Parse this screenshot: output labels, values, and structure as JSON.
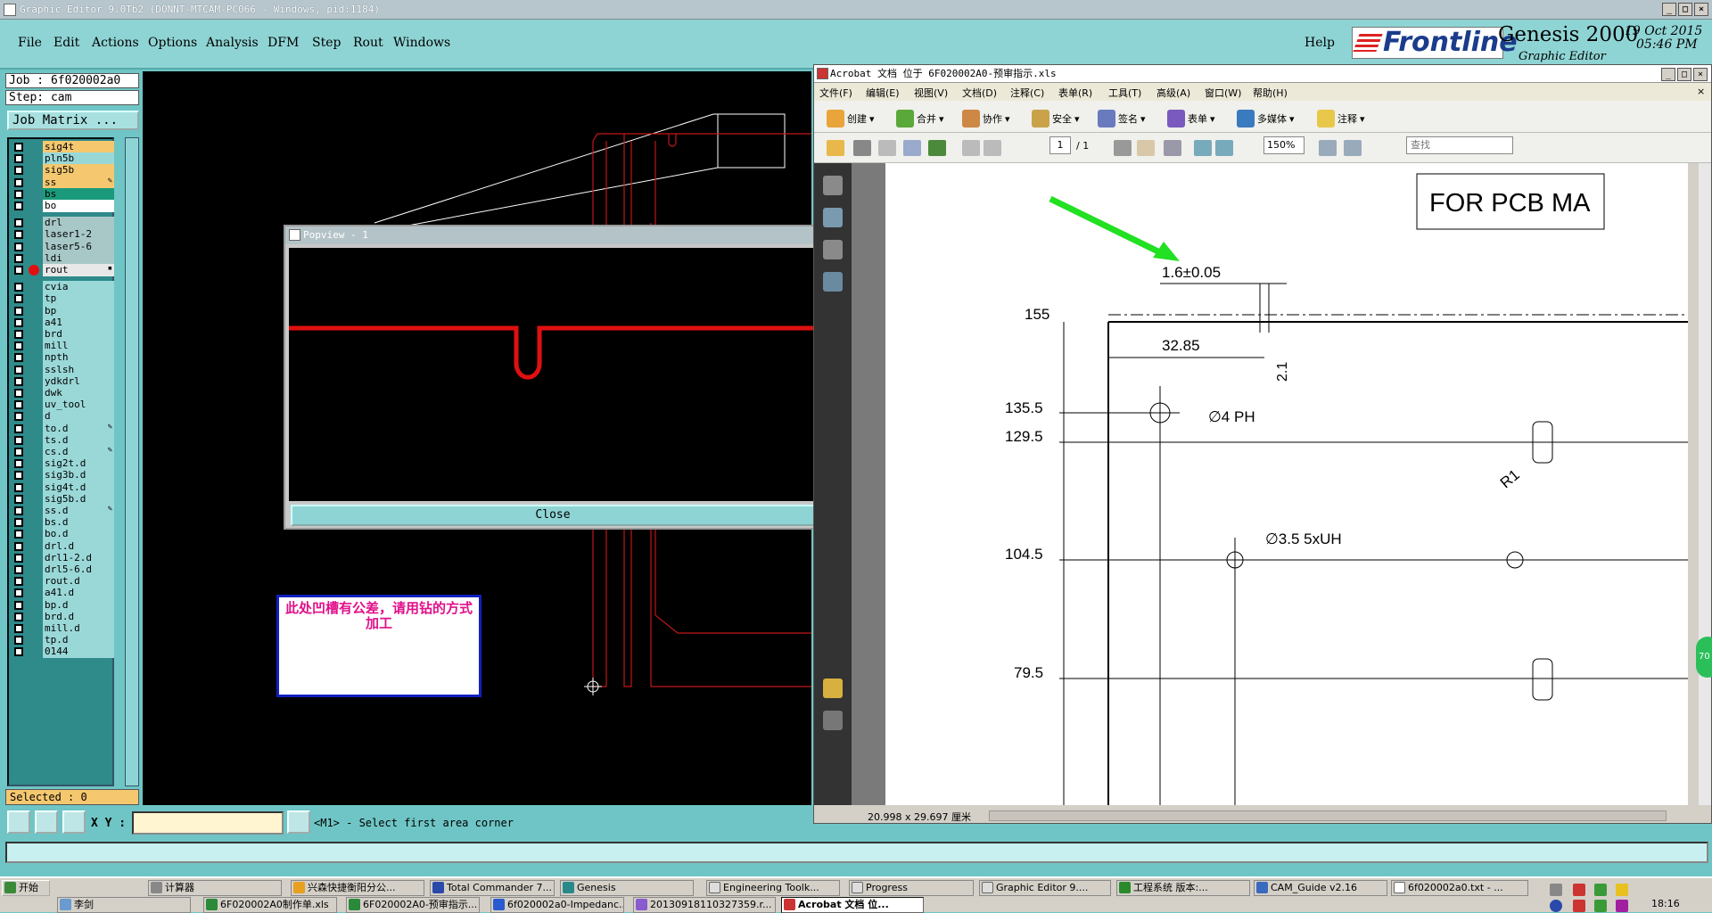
{
  "window_title": "Graphic Editor 9.0Tb2 (DONNT-MTCAM-PC066 - Windows, pid:1184)",
  "menu": {
    "items": [
      "File",
      "Edit",
      "Actions",
      "Options",
      "Analysis",
      "DFM",
      "Step",
      "Rout",
      "Windows"
    ],
    "help": "Help"
  },
  "brand": {
    "logo": "Frontline",
    "product": "Genesis 2000",
    "subtitle": "Graphic Editor",
    "date": "19 Oct 2015",
    "time": "05:46 PM"
  },
  "job": {
    "job_line": "Job : 6f020002a0",
    "step_line": "Step: cam",
    "matrix_button": "Job Matrix ..."
  },
  "layers": [
    {
      "name": "sig4t",
      "color": "#f5c870",
      "tag": ""
    },
    {
      "name": "pln5b",
      "color": "#9ad8d8",
      "tag": ""
    },
    {
      "name": "sig5b",
      "color": "#f5c870",
      "tag": ""
    },
    {
      "name": "ss",
      "color": "#f5c870",
      "tag": "✎"
    },
    {
      "name": "bs",
      "color": "#1a9a7a",
      "tag": ""
    },
    {
      "name": "bo",
      "color": "#ffffff",
      "tag": ""
    },
    {
      "name": "drl",
      "color": "#a8c8c8",
      "tag": ""
    },
    {
      "name": "laser1-2",
      "color": "#a8c8c8",
      "tag": ""
    },
    {
      "name": "laser5-6",
      "color": "#a8c8c8",
      "tag": ""
    },
    {
      "name": "ldi",
      "color": "#a8c8c8",
      "tag": ""
    },
    {
      "name": "rout",
      "color": "#e8e8e8",
      "tag": "▪"
    },
    {
      "name": "cvia",
      "color": "#9ad8d8",
      "tag": ""
    },
    {
      "name": "tp",
      "color": "#9ad8d8",
      "tag": ""
    },
    {
      "name": "bp",
      "color": "#9ad8d8",
      "tag": ""
    },
    {
      "name": "a41",
      "color": "#9ad8d8",
      "tag": ""
    },
    {
      "name": "brd",
      "color": "#9ad8d8",
      "tag": ""
    },
    {
      "name": "mill",
      "color": "#9ad8d8",
      "tag": ""
    },
    {
      "name": "npth",
      "color": "#9ad8d8",
      "tag": ""
    },
    {
      "name": "sslsh",
      "color": "#9ad8d8",
      "tag": ""
    },
    {
      "name": "ydkdrl",
      "color": "#9ad8d8",
      "tag": ""
    },
    {
      "name": "dwk",
      "color": "#9ad8d8",
      "tag": ""
    },
    {
      "name": "uv_tool",
      "color": "#9ad8d8",
      "tag": ""
    },
    {
      "name": "d",
      "color": "#9ad8d8",
      "tag": ""
    },
    {
      "name": "to.d",
      "color": "#9ad8d8",
      "tag": "✎"
    },
    {
      "name": "ts.d",
      "color": "#9ad8d8",
      "tag": ""
    },
    {
      "name": "cs.d",
      "color": "#9ad8d8",
      "tag": "✎"
    },
    {
      "name": "sig2t.d",
      "color": "#9ad8d8",
      "tag": ""
    },
    {
      "name": "sig3b.d",
      "color": "#9ad8d8",
      "tag": ""
    },
    {
      "name": "sig4t.d",
      "color": "#9ad8d8",
      "tag": ""
    },
    {
      "name": "sig5b.d",
      "color": "#9ad8d8",
      "tag": ""
    },
    {
      "name": "ss.d",
      "color": "#9ad8d8",
      "tag": "✎"
    },
    {
      "name": "bs.d",
      "color": "#9ad8d8",
      "tag": ""
    },
    {
      "name": "bo.d",
      "color": "#9ad8d8",
      "tag": ""
    },
    {
      "name": "drl.d",
      "color": "#9ad8d8",
      "tag": ""
    },
    {
      "name": "drl1-2.d",
      "color": "#9ad8d8",
      "tag": ""
    },
    {
      "name": "drl5-6.d",
      "color": "#9ad8d8",
      "tag": ""
    },
    {
      "name": "rout.d",
      "color": "#9ad8d8",
      "tag": ""
    },
    {
      "name": "a41.d",
      "color": "#9ad8d8",
      "tag": ""
    },
    {
      "name": "bp.d",
      "color": "#9ad8d8",
      "tag": ""
    },
    {
      "name": "brd.d",
      "color": "#9ad8d8",
      "tag": ""
    },
    {
      "name": "mill.d",
      "color": "#9ad8d8",
      "tag": ""
    },
    {
      "name": "tp.d",
      "color": "#9ad8d8",
      "tag": ""
    },
    {
      "name": "0144",
      "color": "#9ad8d8",
      "tag": ""
    }
  ],
  "selected_status": "Selected : 0",
  "popview": {
    "title": "Popview - 1",
    "close_label": "Close"
  },
  "note": "此处凹槽有公差，请用钻的方式加工",
  "bottom": {
    "xy_label": "X Y :",
    "xy_value": "",
    "prompt": "<M1> - Select first area corner"
  },
  "acrobat": {
    "title": "Acrobat 文档 位于 6F020002A0-预审指示.xls",
    "menu": [
      "文件(F)",
      "编辑(E)",
      "视图(V)",
      "文档(D)",
      "注释(C)",
      "表单(R)",
      "工具(T)",
      "高级(A)",
      "窗口(W)",
      "帮助(H)"
    ],
    "toolbar": [
      "创建",
      "合并",
      "协作",
      "安全",
      "签名",
      "表单",
      "多媒体",
      "注释"
    ],
    "page_current": "1",
    "page_total": "/ 1",
    "zoom": "150%",
    "find_placeholder": "查找",
    "page_size": "20.998 x 29.697 厘米"
  },
  "drawing": {
    "header_box": "FOR PCB MA",
    "dim_slot": "1.6±0.05",
    "dim_width": "32.85",
    "dim_depth": "2.1",
    "hole_4ph": "∅4 PH",
    "hole_35": "∅3.5 5xUH",
    "radius": "R1",
    "y_labels": [
      "155",
      "135.5",
      "129.5",
      "104.5",
      "79.5"
    ],
    "badge": "70"
  },
  "taskbar": {
    "start": "开始",
    "row1": [
      "计算器",
      "兴森快捷衡阳分公...",
      "Total Commander 7...",
      "Genesis",
      "Engineering Toolk...",
      "Progress",
      "Graphic Editor 9....",
      "工程系统  版本:...",
      "CAM_Guide v2.16",
      "6f020002a0.txt - ..."
    ],
    "row2": [
      "李剑",
      "6F020002A0制作单.xls",
      "6F020002A0-预审指示...",
      "6f020002a0-Impedanc...",
      "20130918110327359.r...",
      "Acrobat 文档 位..."
    ],
    "clock": "18:16"
  }
}
